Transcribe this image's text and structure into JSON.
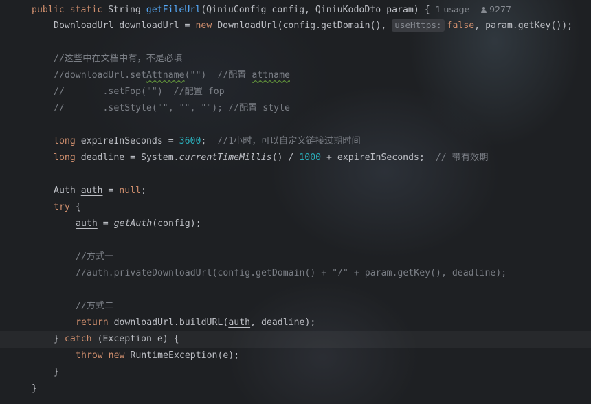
{
  "code": {
    "l1": {
      "kw_public": "public",
      "kw_static": "static",
      "type": "String",
      "method": "getFileUrl",
      "params": "(QiniuConfig config, QiniuKodoDto param) {"
    },
    "usage": "1 usage",
    "author_id": "9277",
    "l2": {
      "pre": "DownloadUrl downloadUrl = ",
      "kw_new": "new",
      "call": " DownloadUrl(config.getDomain(), ",
      "hint": "useHttps:",
      "kw_false": "false",
      "post": ", param.getKey());"
    },
    "c1": "//这些中在文档中有，不是必填",
    "c2a": "//downloadUrl.set",
    "c2b": "Attname",
    "c2c": "(\"\")  //配置 ",
    "c2d": "attname",
    "c3": "//       .setFop(\"\")  //配置 fop",
    "c4": "//       .setStyle(\"\", \"\", \"\"); //配置 style",
    "l5": {
      "kw_long": "long",
      "name": " expireInSeconds = ",
      "num": "3600",
      "semi": ";  ",
      "cmt": "//1小时，可以自定义链接过期时间"
    },
    "l6": {
      "kw_long": "long",
      "pre": " deadline = System.",
      "static_call": "currentTimeMillis",
      "mid": "() / ",
      "num": "1000",
      "post": " + expireInSeconds;  ",
      "cmt": "// 带有效期"
    },
    "l7": {
      "type": "Auth ",
      "var": "auth",
      "eq": " = ",
      "kw_null": "null",
      "semi": ";"
    },
    "l8": {
      "kw_try": "try",
      "brace": " {"
    },
    "l9": {
      "var": "auth",
      "eq": " = ",
      "static_call": "getAuth",
      "args": "(config);"
    },
    "c5": "//方式一",
    "c6": "//auth.privateDownloadUrl(config.getDomain() + \"/\" + param.getKey(), deadline);",
    "c7": "//方式二",
    "l10": {
      "kw_return": "return",
      "pre": " downloadUrl.buildURL(",
      "var": "auth",
      "post": ", deadline);"
    },
    "l11": {
      "pre": "} ",
      "kw_catch": "catch",
      "post": " (Exception e) {"
    },
    "l12": {
      "kw_throw": "throw",
      "sp": " ",
      "kw_new": "new",
      "post": " RuntimeException(e);"
    },
    "l13": "}",
    "l14": "}"
  },
  "colors": {
    "keyword": "#cf8e6d",
    "method": "#56a8f5",
    "number": "#2aacb8",
    "comment": "#7a7e85",
    "text": "#bcbec4"
  }
}
